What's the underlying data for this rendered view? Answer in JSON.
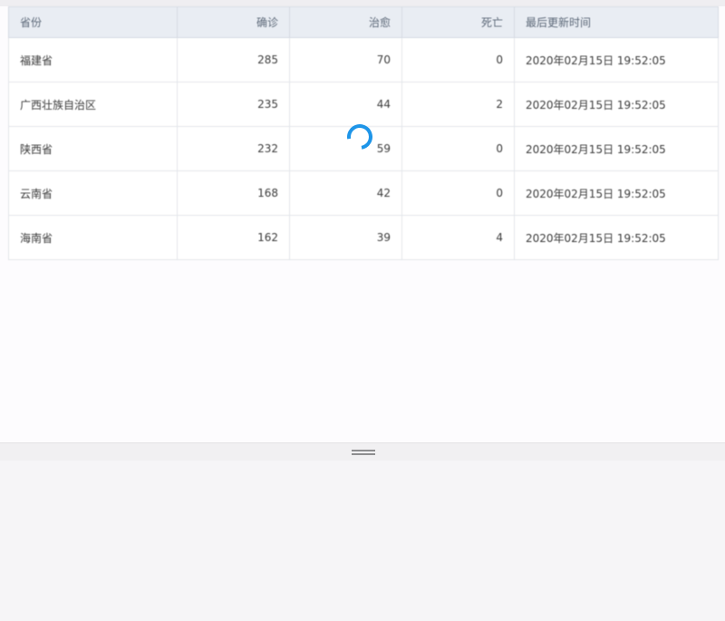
{
  "table": {
    "headers": {
      "province": "省份",
      "confirmed": "确诊",
      "cured": "治愈",
      "deaths": "死亡",
      "updated": "最后更新时间"
    },
    "rows": [
      {
        "province": "福建省",
        "confirmed": "285",
        "cured": "70",
        "deaths": "0",
        "updated": "2020年02月15日 19:52:05"
      },
      {
        "province": "广西壮族自治区",
        "confirmed": "235",
        "cured": "44",
        "deaths": "2",
        "updated": "2020年02月15日 19:52:05"
      },
      {
        "province": "陕西省",
        "confirmed": "232",
        "cured": "59",
        "deaths": "0",
        "updated": "2020年02月15日 19:52:05"
      },
      {
        "province": "云南省",
        "confirmed": "168",
        "cured": "42",
        "deaths": "0",
        "updated": "2020年02月15日 19:52:05"
      },
      {
        "province": "海南省",
        "confirmed": "162",
        "cured": "39",
        "deaths": "4",
        "updated": "2020年02月15日 19:52:05"
      }
    ]
  },
  "icons": {
    "spinner": "loading-spinner-icon",
    "grip": "drag-handle-icon"
  },
  "colors": {
    "spinner": "#1e95e8",
    "header_bg": "#e9edf3"
  }
}
